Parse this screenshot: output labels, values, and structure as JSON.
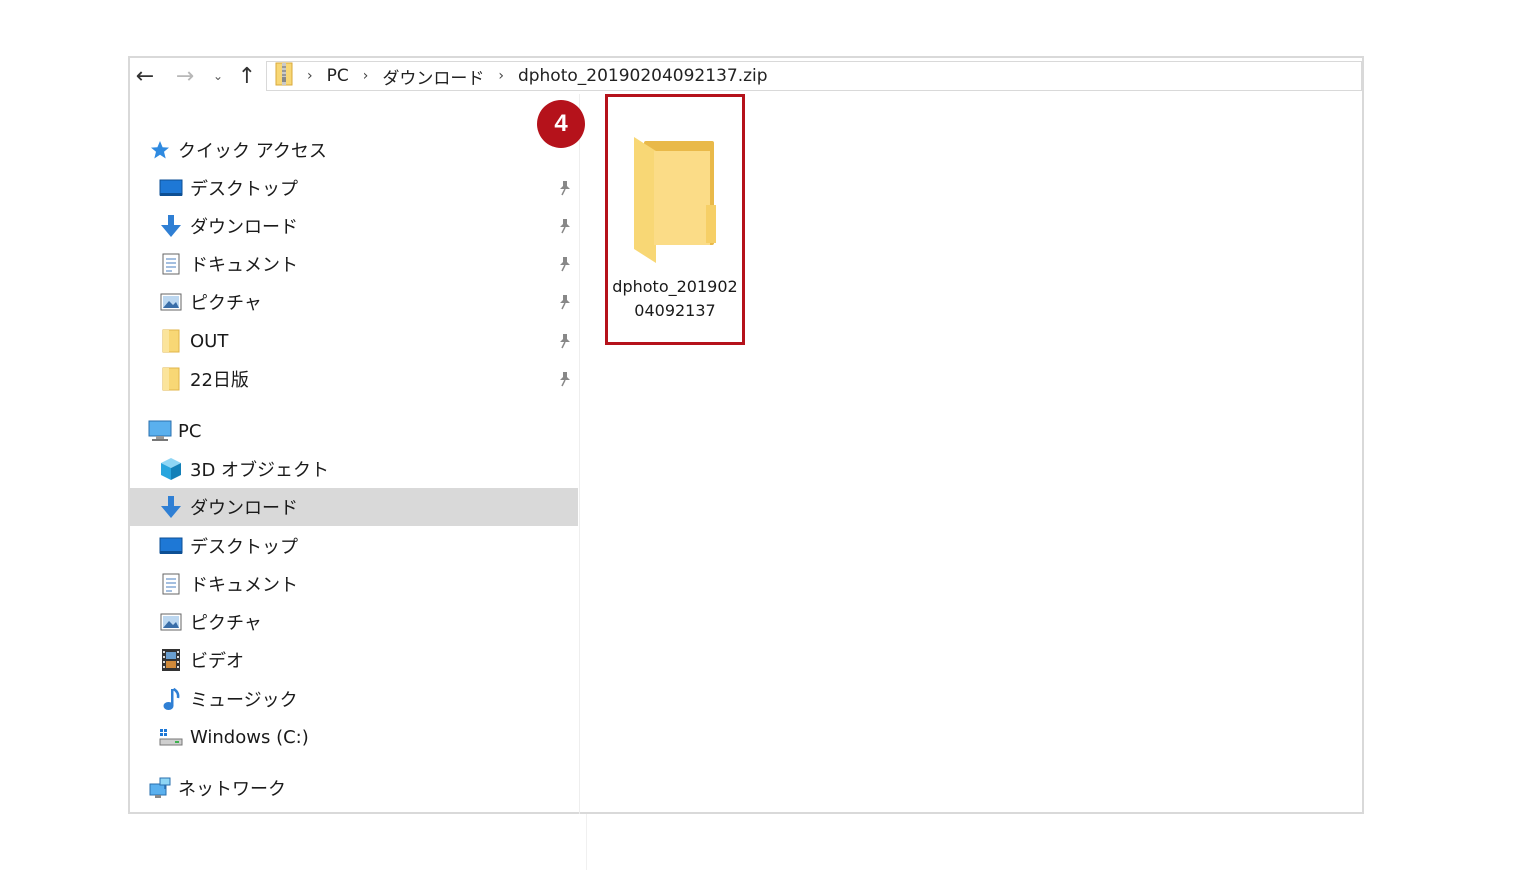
{
  "address_bar": {
    "crumbs": [
      "PC",
      "ダウンロード",
      "dphoto_20190204092137.zip"
    ]
  },
  "sidebar": {
    "quick_access": {
      "label": "クイック アクセス",
      "items": [
        {
          "label": "デスクトップ",
          "icon": "desktop-icon",
          "pinned": true
        },
        {
          "label": "ダウンロード",
          "icon": "download-icon",
          "pinned": true
        },
        {
          "label": "ドキュメント",
          "icon": "document-icon",
          "pinned": true
        },
        {
          "label": "ピクチャ",
          "icon": "picture-icon",
          "pinned": true
        },
        {
          "label": "OUT",
          "icon": "folder-icon",
          "pinned": true
        },
        {
          "label": "22日版",
          "icon": "folder-icon",
          "pinned": true
        }
      ]
    },
    "pc": {
      "label": "PC",
      "items": [
        {
          "label": "3D オブジェクト",
          "icon": "3d-objects-icon"
        },
        {
          "label": "ダウンロード",
          "icon": "download-icon",
          "selected": true
        },
        {
          "label": "デスクトップ",
          "icon": "desktop-icon"
        },
        {
          "label": "ドキュメント",
          "icon": "document-icon"
        },
        {
          "label": "ピクチャ",
          "icon": "picture-icon"
        },
        {
          "label": "ビデオ",
          "icon": "video-icon"
        },
        {
          "label": "ミュージック",
          "icon": "music-icon"
        },
        {
          "label": "Windows (C:)",
          "icon": "drive-icon"
        }
      ]
    },
    "network": {
      "label": "ネットワーク",
      "icon": "network-icon"
    }
  },
  "content": {
    "folder": {
      "name": "dphoto_20190204092137",
      "icon": "folder-icon"
    }
  },
  "annotation": {
    "step": "4",
    "color": "#b5121b"
  },
  "colors": {
    "folder": "#f8d775",
    "selection": "#d9d9d9",
    "accent_blue": "#1e78d6"
  }
}
